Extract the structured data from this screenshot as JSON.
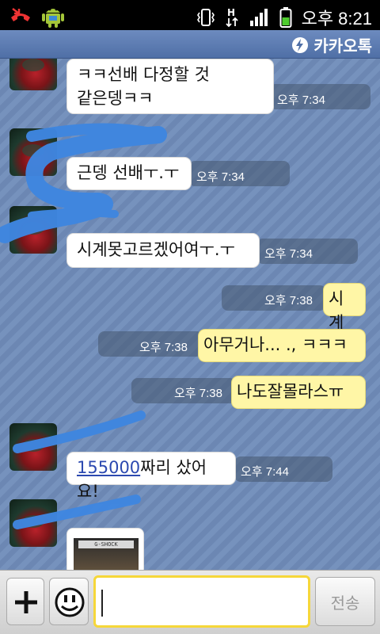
{
  "status_bar": {
    "time": "오후 8:21",
    "icons": [
      "missed-call-icon",
      "android-icon",
      "vibrate-icon",
      "hspa-data-icon",
      "signal-icon",
      "battery-icon"
    ]
  },
  "app": {
    "brand": "카카오톡"
  },
  "messages": [
    {
      "side": "in",
      "text_line1": "ㅋㅋ선배 다정할 것",
      "text_line2": "같은뎅ㅋㅋ",
      "time": "오후 7:34"
    },
    {
      "side": "in",
      "text": "근뎅 선배ㅜ.ㅜ",
      "time": "오후 7:34"
    },
    {
      "side": "in",
      "text": "시계못고르겠어여ㅜ.ㅜ",
      "time": "오후 7:34"
    },
    {
      "side": "out",
      "text": "시계",
      "time": "오후 7:38"
    },
    {
      "side": "out",
      "text": "아무거나... ., ㅋㅋㅋ",
      "time": "오후 7:38"
    },
    {
      "side": "out",
      "text": "나도잘몰라스ㅠ",
      "time": "오후 7:38"
    },
    {
      "side": "in",
      "link": "155000",
      "text_after": "짜리 샀어요!",
      "time": "오후 7:44"
    },
    {
      "side": "in",
      "image": true,
      "image_label": "G-SHOCK"
    }
  ],
  "input": {
    "placeholder": "",
    "value": "",
    "send_label": "전송"
  },
  "colors": {
    "bg": "#6c87b3",
    "appbar": "#5a79ad",
    "in_bubble": "#ffffff",
    "out_bubble": "#fff6a6",
    "scribble": "#3f86e0",
    "input_focus": "#f6d73a"
  }
}
